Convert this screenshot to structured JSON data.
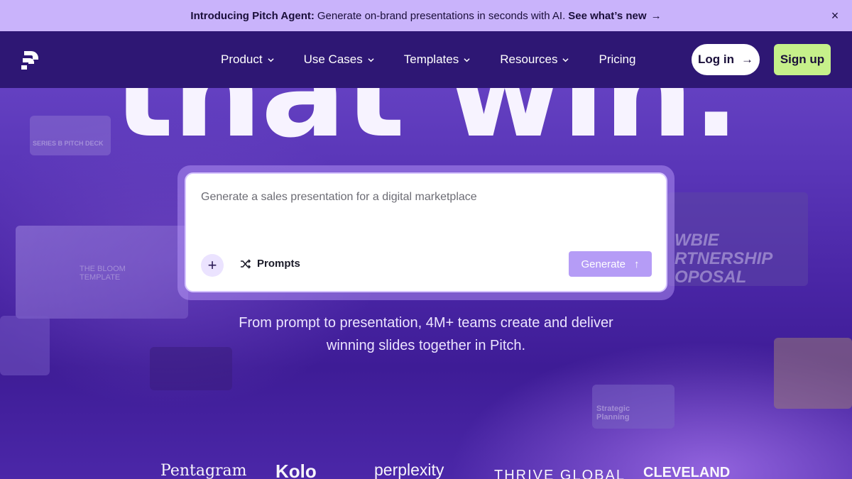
{
  "announcement": {
    "strong": "Introducing Pitch Agent:",
    "text": "Generate on-brand presentations in seconds with AI.",
    "link": "See what’s new",
    "arrow": "→",
    "close": "×"
  },
  "nav": {
    "items": [
      {
        "label": "Product",
        "has_dropdown": true
      },
      {
        "label": "Use Cases",
        "has_dropdown": true
      },
      {
        "label": "Templates",
        "has_dropdown": true
      },
      {
        "label": "Resources",
        "has_dropdown": true
      },
      {
        "label": "Pricing",
        "has_dropdown": false
      }
    ],
    "login_label": "Log in",
    "login_arrow": "→",
    "signup_label": "Sign up"
  },
  "hero": {
    "headline": "that win.",
    "prompt": {
      "placeholder": "Generate a sales presentation for a digital marketplace",
      "plus": "+",
      "prompts_label": "Prompts",
      "generate_label": "Generate",
      "generate_icon": "↑"
    },
    "subtitle_line1": "From prompt to presentation, 4M+ teams create and deliver",
    "subtitle_line2": "winning slides together in Pitch."
  },
  "thumbnails": {
    "left_top": "SERIES B PITCH DECK",
    "left_mid": "THE BLOOM TEMPLATE",
    "right_big_1": "WBIE",
    "right_big_2": "RTNERSHIP",
    "right_big_3": "OPOSAL",
    "right_small": "Strategic Planning"
  },
  "logos": [
    "Pentagram",
    "Kolo",
    "perplexity",
    "THRIVE GLOBAL",
    "CLEVELAND"
  ],
  "colors": {
    "announcement_bg": "#c9b3fb",
    "nav_bg": "#2e1774",
    "signup_bg": "#c6f08a",
    "generate_bg": "#b59cf6"
  }
}
